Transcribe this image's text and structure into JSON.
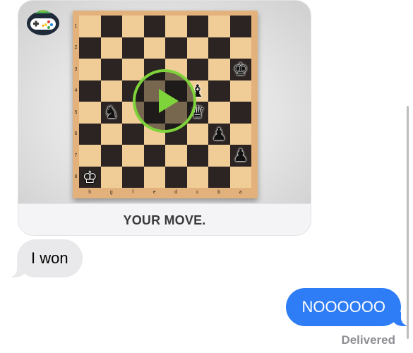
{
  "game_card": {
    "app_icon": "game-controller-parrot-icon",
    "play_icon": "play-icon",
    "caption": "YOUR MOVE.",
    "board": {
      "ranks": [
        "1",
        "2",
        "3",
        "4",
        "5",
        "6",
        "7",
        "8"
      ],
      "files": [
        "h",
        "g",
        "f",
        "e",
        "d",
        "c",
        "b",
        "a"
      ],
      "pieces": [
        {
          "row": 2,
          "col": 7,
          "glyph": "♚",
          "side": "black",
          "name": "black-king-icon"
        },
        {
          "row": 3,
          "col": 5,
          "glyph": "♝",
          "side": "black",
          "name": "black-bishop-icon"
        },
        {
          "row": 4,
          "col": 1,
          "glyph": "♞",
          "side": "black",
          "name": "black-knight-icon"
        },
        {
          "row": 4,
          "col": 5,
          "glyph": "♛",
          "side": "black",
          "name": "black-queen-icon"
        },
        {
          "row": 5,
          "col": 6,
          "glyph": "♟",
          "side": "black",
          "name": "black-pawn-icon"
        },
        {
          "row": 6,
          "col": 7,
          "glyph": "♟",
          "side": "black",
          "name": "black-pawn-icon"
        },
        {
          "row": 7,
          "col": 0,
          "glyph": "♔",
          "side": "white",
          "name": "white-king-icon"
        }
      ]
    }
  },
  "messages": [
    {
      "direction": "incoming",
      "text": "I won"
    },
    {
      "direction": "outgoing",
      "text": "NOOOOOO"
    }
  ],
  "status": {
    "delivered": "Delivered"
  },
  "colors": {
    "outgoing_bubble": "#2f7df6",
    "incoming_bubble": "#e9e9eb",
    "play_accent": "#7ed23a"
  }
}
